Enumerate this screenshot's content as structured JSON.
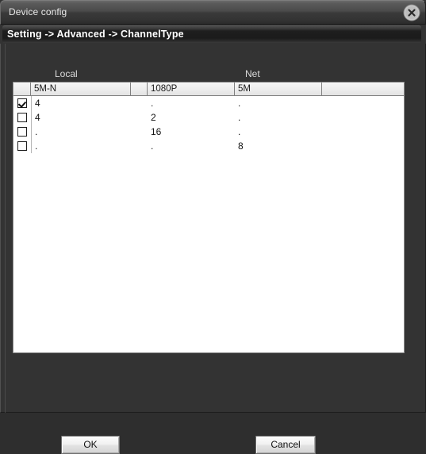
{
  "window": {
    "title": "Device config",
    "close_icon": "close-icon"
  },
  "breadcrumb": {
    "text": "Setting -> Advanced -> ChannelType"
  },
  "groups": {
    "local_label": "Local",
    "net_label": "Net"
  },
  "table": {
    "headers": {
      "select": "",
      "col_5mn": "5M-N",
      "gap": "",
      "col_1080p": "1080P",
      "col_5m": "5M",
      "tail": ""
    },
    "rows": [
      {
        "checked": true,
        "c5mn": "4",
        "c1080p": ".",
        "c5m": "."
      },
      {
        "checked": false,
        "c5mn": "4",
        "c1080p": "2",
        "c5m": "."
      },
      {
        "checked": false,
        "c5mn": ".",
        "c1080p": "16",
        "c5m": "."
      },
      {
        "checked": false,
        "c5mn": ".",
        "c1080p": ".",
        "c5m": "8"
      }
    ]
  },
  "footer": {
    "ok_label": "OK",
    "cancel_label": "Cancel"
  },
  "colors": {
    "window_bg": "#333333",
    "titlebar_top": "#6a6a6a",
    "panel_bg": "#ffffff",
    "text_light": "#e8e8e8",
    "text_dark": "#111111"
  }
}
